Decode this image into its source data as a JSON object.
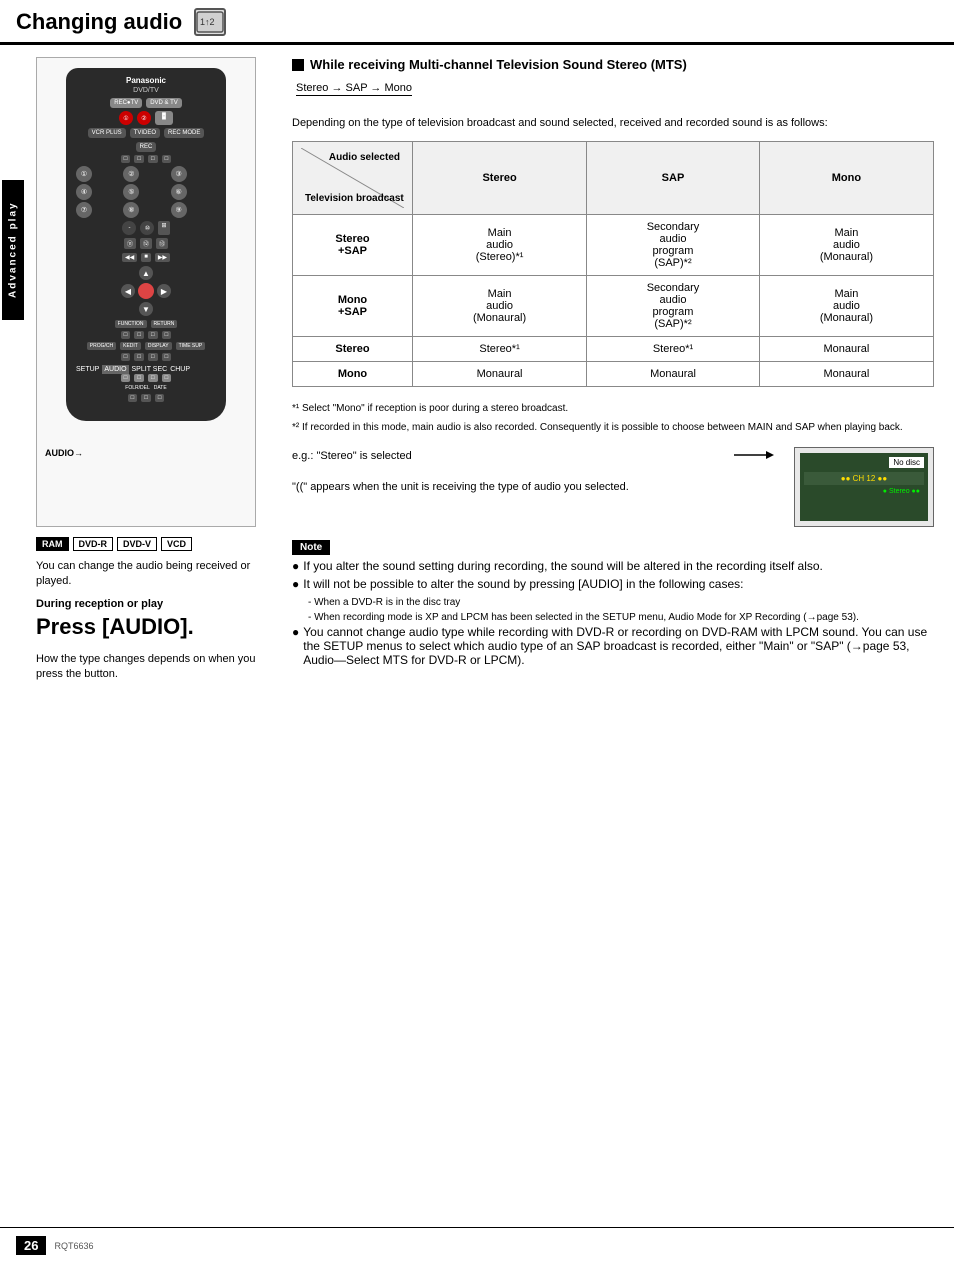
{
  "header": {
    "title": "Changing audio",
    "icon_text": "1↑2"
  },
  "side_tab": "Advanced play",
  "left_column": {
    "badge_labels": [
      "RAM",
      "DVD-R",
      "DVD-V",
      "VCD"
    ],
    "intro_text": "You can change the audio being received or played.",
    "during_label": "During reception or play",
    "press_label": "Press [AUDIO].",
    "how_text": "How the type changes depends on when you press the button.",
    "audio_arrow_label": "AUDIO"
  },
  "right_column": {
    "mts_square": "■",
    "mts_title": "While receiving Multi-channel Television Sound Stereo (MTS)",
    "stereo_chain": "Stereo → SAP → Mono",
    "depending_text": "Depending on the type of television broadcast and sound selected, received and recorded sound is as follows:",
    "table": {
      "header_audio": "Audio selected",
      "header_tv": "Television broadcast",
      "col_stereo": "Stereo",
      "col_sap": "SAP",
      "col_mono": "Mono",
      "rows": [
        {
          "label": "Stereo +SAP",
          "stereo": "Main audio (Stereo)*¹",
          "sap": "Secondary audio program (SAP)*²",
          "mono": "Main audio (Monaural)"
        },
        {
          "label": "Mono +SAP",
          "stereo": "Main audio (Monaural)",
          "sap": "Secondary audio program (SAP)*²",
          "mono": "Main audio (Monaural)"
        },
        {
          "label": "Stereo",
          "stereo": "Stereo*¹",
          "sap": "Stereo*¹",
          "mono": "Monaural"
        },
        {
          "label": "Mono",
          "stereo": "Monaural",
          "sap": "Monaural",
          "mono": "Monaural"
        }
      ]
    },
    "footnote1": "*¹  Select \"Mono\" if reception is poor during a stereo broadcast.",
    "footnote2": "*²  If recorded in this mode, main audio is also recorded. Consequently it is possible to choose between MAIN and SAP when playing back.",
    "screen_caption1": "e.g.: \"Stereo\" is selected",
    "screen_caption2": "\"((\" appears when the unit is receiving the type of audio you selected.",
    "screen_no_disc": "No disc",
    "screen_channel": "●●CH 12●●",
    "screen_stereo": "●Stereo●●",
    "note_header": "Note",
    "note_bullets": [
      "If you alter the sound setting during recording, the sound will be altered in the recording itself also.",
      "It will not be possible to alter the sound by pressing [AUDIO] in the following cases:",
      "You cannot change audio type while recording with DVD-R or recording on DVD-RAM with LPCM sound. You can use the SETUP menus to select which audio type of an SAP broadcast is recorded, either \"Main\" or \"SAP\" (→page 53, Audio—Select MTS for DVD-R or LPCM)."
    ],
    "note_sub_bullets": [
      "- When a DVD-R is in the disc tray",
      "- When recording mode is XP and LPCM has been selected in the SETUP menu, Audio Mode for XP Recording (→page 53)."
    ]
  },
  "page": {
    "number": "26",
    "code": "RQT6636"
  }
}
